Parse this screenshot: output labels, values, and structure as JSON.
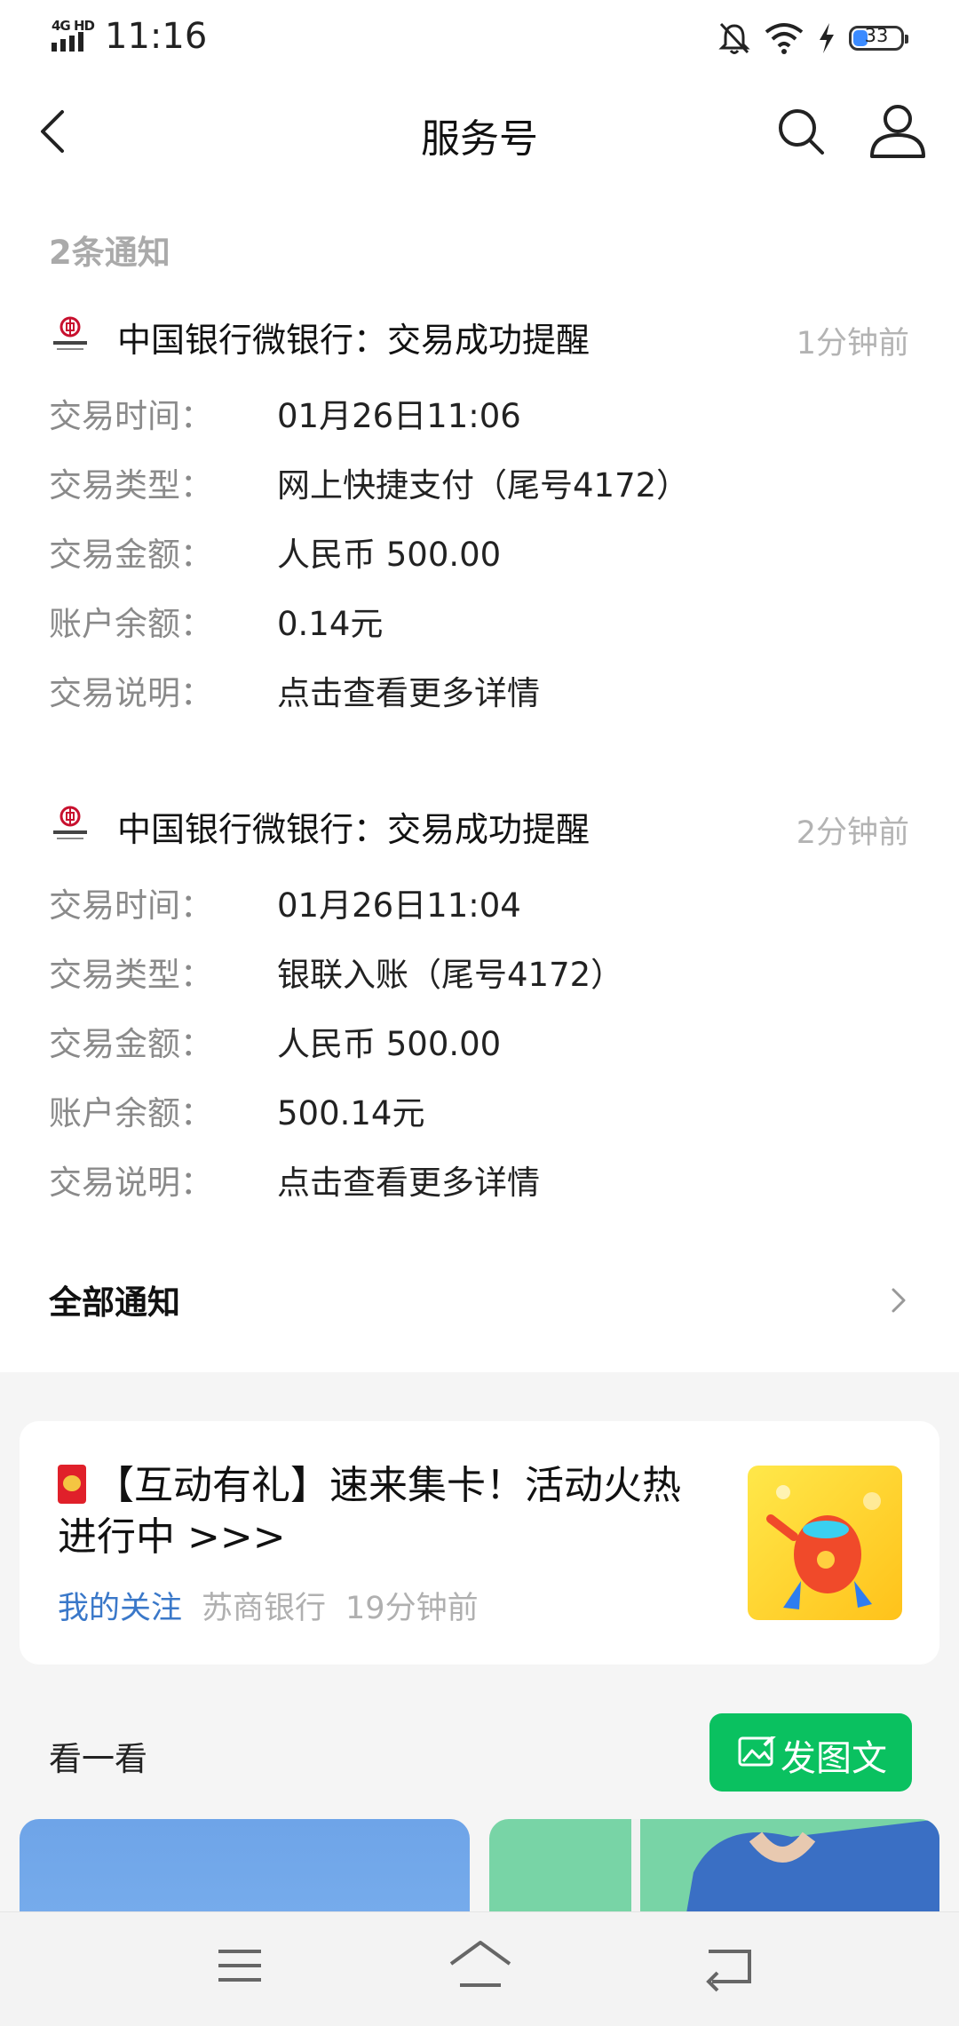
{
  "status_bar": {
    "network": "4G HD",
    "time": "11:16",
    "battery": "33"
  },
  "header": {
    "title": "服务号"
  },
  "notification_count": "2条通知",
  "notifications": [
    {
      "title": "中国银行微银行：交易成功提醒",
      "time_ago": "1分钟前",
      "rows": [
        {
          "label": "交易时间：",
          "value": "01月26日11:06"
        },
        {
          "label": "交易类型：",
          "value": "网上快捷支付（尾号4172）"
        },
        {
          "label": "交易金额：",
          "value": "人民币 500.00"
        },
        {
          "label": "账户余额：",
          "value": "0.14元"
        },
        {
          "label": "交易说明：",
          "value": "点击查看更多详情"
        }
      ]
    },
    {
      "title": "中国银行微银行：交易成功提醒",
      "time_ago": "2分钟前",
      "rows": [
        {
          "label": "交易时间：",
          "value": "01月26日11:04"
        },
        {
          "label": "交易类型：",
          "value": "银联入账（尾号4172）"
        },
        {
          "label": "交易金额：",
          "value": "人民币 500.00"
        },
        {
          "label": "账户余额：",
          "value": "500.14元"
        },
        {
          "label": "交易说明：",
          "value": "点击查看更多详情"
        }
      ]
    }
  ],
  "all_notices": {
    "label": "全部通知"
  },
  "promo": {
    "text": "【互动有礼】速来集卡！活动火热进行中 >>>",
    "tag": "我的关注",
    "source": "苏商银行",
    "time_ago": "19分钟前"
  },
  "look": {
    "label": "看一看",
    "post_button": "发图文"
  },
  "colors": {
    "accent_green": "#0ac160",
    "link_blue": "#3a78c9",
    "muted_gray": "#b3b3b3"
  }
}
